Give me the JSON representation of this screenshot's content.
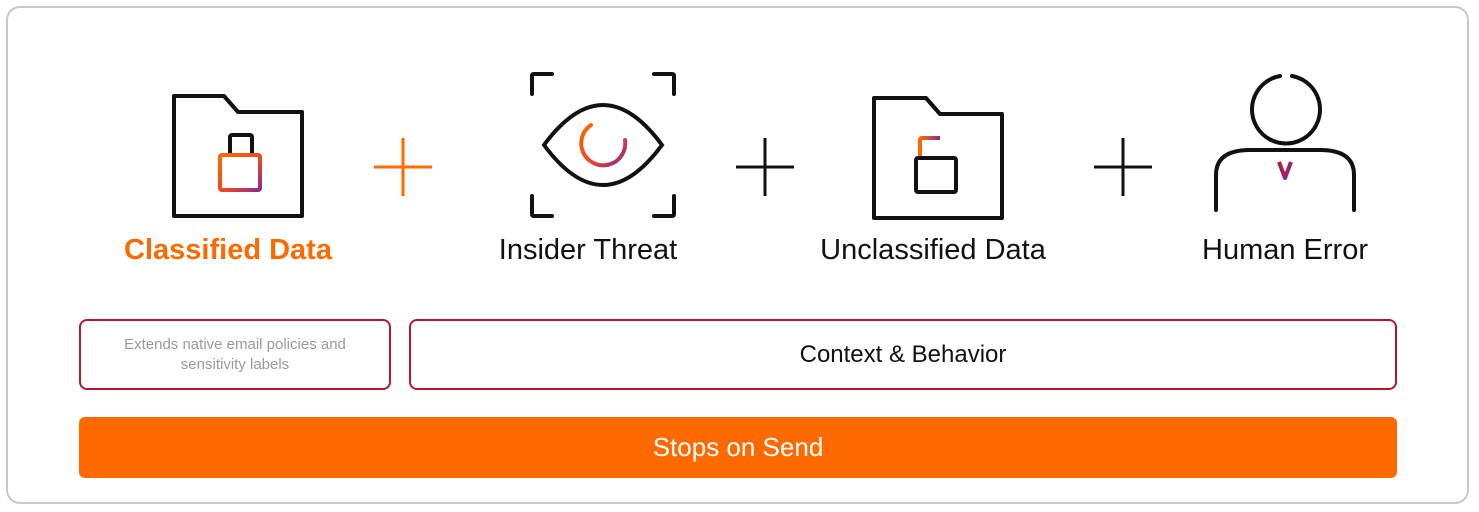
{
  "colors": {
    "accent": "#ff6a00",
    "border_red": "#b0192f",
    "purple": "#8a2b8e",
    "stroke": "#111111"
  },
  "items": [
    {
      "label": "Classified Data",
      "icon": "locked-folder-icon"
    },
    {
      "label": "Insider Threat",
      "icon": "eye-scan-icon"
    },
    {
      "label": "Unclassified Data",
      "icon": "unlocked-folder-icon"
    },
    {
      "label": "Human Error",
      "icon": "person-icon"
    }
  ],
  "operators": [
    "+",
    "+",
    "+"
  ],
  "boxes": {
    "note": "Extends native email policies and sensitivity labels",
    "context": "Context & Behavior"
  },
  "cta": {
    "label": "Stops on Send"
  }
}
